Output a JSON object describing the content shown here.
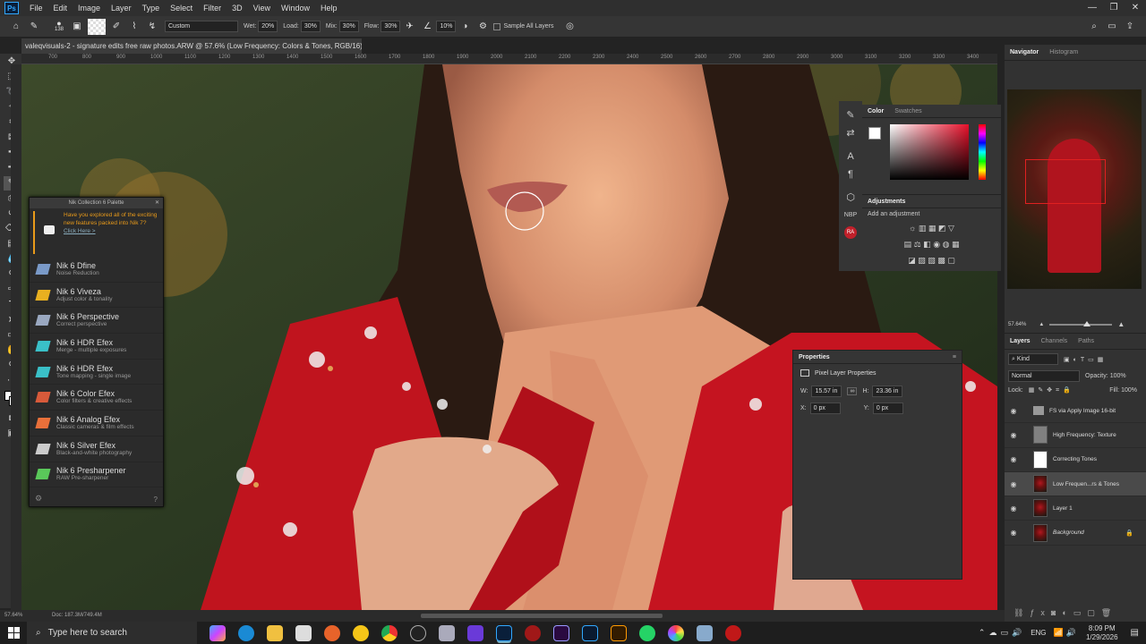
{
  "menubar": {
    "logo": "Ps",
    "items": [
      "File",
      "Edit",
      "Image",
      "Layer",
      "Type",
      "Select",
      "Filter",
      "3D",
      "View",
      "Window",
      "Help"
    ],
    "win_controls": [
      "—",
      "❐",
      "✕"
    ]
  },
  "options": {
    "brush_size": "138",
    "preset": "Custom",
    "wet_label": "Wet:",
    "wet_value": "20%",
    "load_label": "Load:",
    "load_value": "30%",
    "mix_label": "Mix:",
    "mix_value": "30%",
    "flow_label": "Flow:",
    "flow_value": "30%",
    "angle_value": "10%",
    "sample_all_layers": "Sample All Layers"
  },
  "document": {
    "tab_title": "valeqvisuals-2 - signature edits free raw photos.ARW @ 57.6% (Low Frequency: Colors & Tones, RGB/16) *",
    "close": "×"
  },
  "ruler": {
    "h_ticks": [
      "700",
      "800",
      "900",
      "1000",
      "1100",
      "1200",
      "1300",
      "1400",
      "1500",
      "1600",
      "1700",
      "1800",
      "1900",
      "2000",
      "2100",
      "2200",
      "2300",
      "2400",
      "2500",
      "2600",
      "2700",
      "2800",
      "2900",
      "3000",
      "3100",
      "3200",
      "3300",
      "3400"
    ]
  },
  "nik": {
    "title": "Nik Collection 6 Palette",
    "promo": "Have you explored all of the exciting new features packed into Nik 7?",
    "promo_link": "Click Here >",
    "items": [
      {
        "name": "Nik 6 Dfine",
        "desc": "Noise Reduction",
        "color": "#7a9ac8"
      },
      {
        "name": "Nik 6 Viveza",
        "desc": "Adjust color & tonality",
        "color": "#e8b020"
      },
      {
        "name": "Nik 6 Perspective",
        "desc": "Correct perspective",
        "color": "#9aa8c0"
      },
      {
        "name": "Nik 6 HDR Efex",
        "desc": "Merge - multiple exposures",
        "color": "#3ac0c8"
      },
      {
        "name": "Nik 6 HDR Efex",
        "desc": "Tone mapping - single image",
        "color": "#3ac0c8"
      },
      {
        "name": "Nik 6 Color Efex",
        "desc": "Color filters & creative effects",
        "color": "#d85a3a"
      },
      {
        "name": "Nik 6 Analog Efex",
        "desc": "Classic cameras & film effects",
        "color": "#e8703a"
      },
      {
        "name": "Nik 6 Silver Efex",
        "desc": "Black-and-white photography",
        "color": "#cccccc"
      },
      {
        "name": "Nik 6 Presharpener",
        "desc": "RAW Pre-sharpener",
        "color": "#5ac85a"
      }
    ]
  },
  "color_panel": {
    "tab_color": "Color",
    "tab_swatches": "Swatches"
  },
  "adjustments": {
    "title": "Adjustments",
    "subtitle": "Add an adjustment"
  },
  "properties": {
    "title": "Properties",
    "kind": "Pixel Layer Properties",
    "w_label": "W:",
    "w_value": "15.57 in",
    "h_label": "H:",
    "h_value": "23.36 in",
    "x_label": "X:",
    "x_value": "0 px",
    "y_label": "Y:",
    "y_value": "0 px"
  },
  "navigator": {
    "tab_navigator": "Navigator",
    "tab_histogram": "Histogram",
    "zoom": "57.64%"
  },
  "layers": {
    "tab_layers": "Layers",
    "tab_channels": "Channels",
    "tab_paths": "Paths",
    "filter_kind": "Kind",
    "blend_mode": "Normal",
    "opacity_label": "Opacity:",
    "opacity_value": "100%",
    "lock_label": "Lock:",
    "fill_label": "Fill:",
    "fill_value": "100%",
    "items": [
      {
        "name": "FS via Apply Image 16-bit",
        "type": "group"
      },
      {
        "name": "High Frequency: Texture",
        "type": "gray"
      },
      {
        "name": "Correcting Tones",
        "type": "white"
      },
      {
        "name": "Low Frequen...rs & Tones",
        "type": "photo",
        "selected": true
      },
      {
        "name": "Layer 1",
        "type": "photo"
      },
      {
        "name": "Background",
        "type": "photo",
        "locked": true
      }
    ]
  },
  "status": {
    "zoom": "57.64%",
    "doc": "Doc: 187.3M/749.4M"
  },
  "taskbar": {
    "search_placeholder": "Type here to search",
    "lang": "ENG",
    "time": "8:09 PM",
    "date": "1/29/2026"
  }
}
